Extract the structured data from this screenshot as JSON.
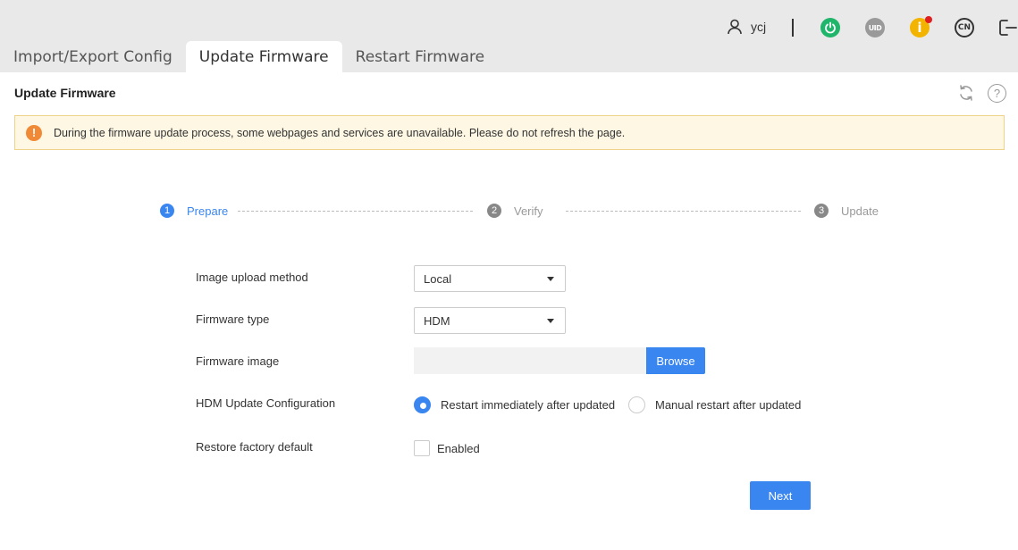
{
  "header": {
    "username": "ycj",
    "uid_label": "UID",
    "info_label": "i",
    "lang_label": "CN",
    "icons": [
      "user-icon",
      "power-icon",
      "uid-icon",
      "info-icon",
      "language-icon",
      "logout-icon"
    ],
    "colors": {
      "power": "#1fb56a",
      "info": "#f3b400",
      "alert_dot": "#e02020"
    }
  },
  "tabs": [
    {
      "label": "Import/Export Config",
      "active": false
    },
    {
      "label": "Update Firmware",
      "active": true
    },
    {
      "label": "Restart Firmware",
      "active": false
    }
  ],
  "page": {
    "title": "Update Firmware",
    "help_glyph": "?",
    "alert_glyph": "!",
    "alert_text": "During the firmware update process, some webpages and services are unavailable. Please do not refresh the page."
  },
  "steps": [
    {
      "num": "1",
      "label": "Prepare",
      "active": true
    },
    {
      "num": "2",
      "label": "Verify",
      "active": false
    },
    {
      "num": "3",
      "label": "Update",
      "active": false
    }
  ],
  "form": {
    "upload_method": {
      "label": "Image upload method",
      "value": "Local"
    },
    "firmware_type": {
      "label": "Firmware type",
      "value": "HDM"
    },
    "firmware_image": {
      "label": "Firmware image",
      "value": "",
      "browse_label": "Browse"
    },
    "hdm_update": {
      "label": "HDM Update Configuration",
      "options": [
        {
          "label": "Restart immediately after updated",
          "checked": true
        },
        {
          "label": "Manual restart after updated",
          "checked": false
        }
      ]
    },
    "restore_factory": {
      "label": "Restore factory default",
      "option_label": "Enabled",
      "checked": false
    }
  },
  "actions": {
    "next_label": "Next"
  },
  "accent_color": "#3a86f0"
}
